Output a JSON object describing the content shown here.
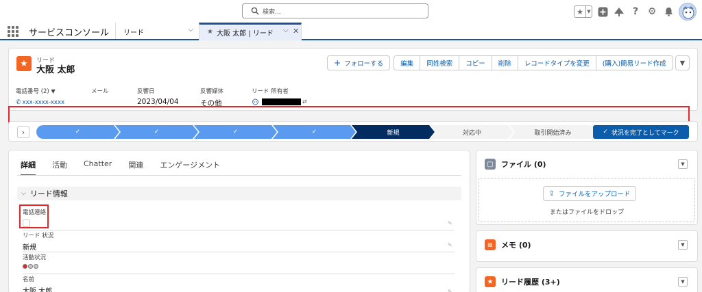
{
  "global_header": {
    "search_placeholder": "検索...",
    "icons": [
      "favorites-icon",
      "favorites-dropdown-icon",
      "global-create-icon",
      "trailhead-icon",
      "help-icon",
      "setup-icon",
      "notifications-icon",
      "user-avatar"
    ]
  },
  "app_nav": {
    "app_name": "サービスコンソール",
    "nav_item": "リード",
    "active_tab": "大阪 太郎 | リード"
  },
  "record": {
    "object_type": "リード",
    "name": "大阪 太郎",
    "actions": {
      "follow": "フォローする",
      "edit": "編集",
      "find_duplicates": "同姓検索",
      "copy": "コピー",
      "delete": "削除",
      "change_record_type": "レコードタイプを変更",
      "create_simple_lead": "(購入)簡易リード作成"
    },
    "highlights": {
      "phone_label": "電話番号 (2)",
      "phone_value": "xxx-xxxx-xxxx",
      "email_label": "メール",
      "response_date_label": "反響日",
      "response_date_value": "2023/04/04",
      "response_media_label": "反響媒体",
      "response_media_value": "その他",
      "owner_label": "リード 所有者"
    }
  },
  "path": {
    "steps": [
      {
        "label": "✓",
        "state": "done"
      },
      {
        "label": "✓",
        "state": "done"
      },
      {
        "label": "✓",
        "state": "done"
      },
      {
        "label": "✓",
        "state": "done"
      },
      {
        "label": "新規",
        "state": "current"
      },
      {
        "label": "対応中",
        "state": "todo"
      },
      {
        "label": "取引開始済み",
        "state": "todo"
      }
    ],
    "mark_complete": "状況を完了としてマーク"
  },
  "detail": {
    "tabs": [
      "詳細",
      "活動",
      "Chatter",
      "関連",
      "エンゲージメント"
    ],
    "section_title": "リード情報",
    "fields": {
      "phone_contact_label": "電話連絡",
      "lead_status_label": "リード 状況",
      "lead_status_value": "新規",
      "activity_status_label": "活動状況",
      "name_label": "名前",
      "name_value": "大阪 太郎"
    }
  },
  "side": {
    "files_title": "ファイル (0)",
    "upload_button": "ファイルをアップロード",
    "drop_text": "またはファイルをドロップ",
    "notes_title": "メモ (0)",
    "history_title": "リード履歴 (3+)"
  },
  "colors": {
    "brand_blue": "#0b5cab",
    "path_done": "#5a9bf0",
    "path_current": "#032d60",
    "lead_orange": "#f26522",
    "highlight_red": "#e3262b"
  }
}
